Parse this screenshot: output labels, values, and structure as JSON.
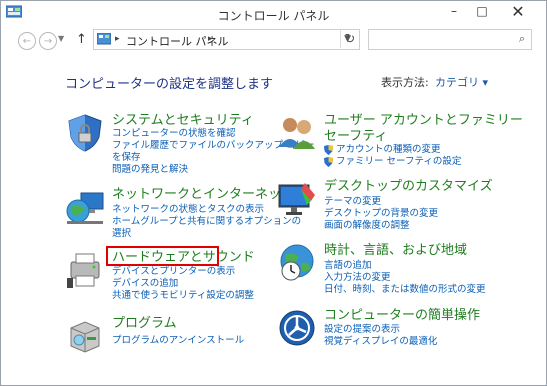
{
  "window": {
    "title": "コントロール パネル",
    "minimize": "–",
    "maximize": "□",
    "close": "✕"
  },
  "address": {
    "crumb": "コントロール パネル",
    "search_placeholder": ""
  },
  "heading": "コンピューターの設定を調整します",
  "view_by": {
    "label": "表示方法:",
    "value": "カテゴリ ▾"
  },
  "categories": {
    "system": {
      "title": "システムとセキュリティ",
      "links": [
        "コンピューターの状態を確認",
        "ファイル履歴でファイルのバックアップ コピー",
        "を保存",
        "問題の発見と解決"
      ]
    },
    "network": {
      "title": "ネットワークとインターネット",
      "links": [
        "ネットワークの状態とタスクの表示",
        "ホームグループと共有に関するオプションの",
        "選択"
      ]
    },
    "hardware": {
      "title": "ハードウェアとサウンド",
      "links": [
        "デバイスとプリンターの表示",
        "デバイスの追加",
        "共通で使うモビリティ設定の調整"
      ]
    },
    "programs": {
      "title": "プログラム",
      "links": [
        "プログラムのアンインストール"
      ]
    },
    "users": {
      "title_line1": "ユーザー アカウントとファミリー",
      "title_line2": "セーフティ",
      "links": [
        "アカウントの種類の変更",
        "ファミリー セーフティの設定"
      ]
    },
    "appearance": {
      "title": "デスクトップのカスタマイズ",
      "links": [
        "テーマの変更",
        "デスクトップの背景の変更",
        "画面の解像度の調整"
      ]
    },
    "clock": {
      "title": "時計、言語、および地域",
      "links": [
        "言語の追加",
        "入力方法の変更",
        "日付、時刻、または数値の形式の変更"
      ]
    },
    "ease": {
      "title": "コンピューターの簡単操作",
      "links": [
        "設定の提案の表示",
        "視覚ディスプレイの最適化"
      ]
    }
  },
  "colors": {
    "link": "#0b5fb5",
    "category_title": "#1e7e1e",
    "heading": "#1e3287",
    "highlight": "#e00000"
  }
}
